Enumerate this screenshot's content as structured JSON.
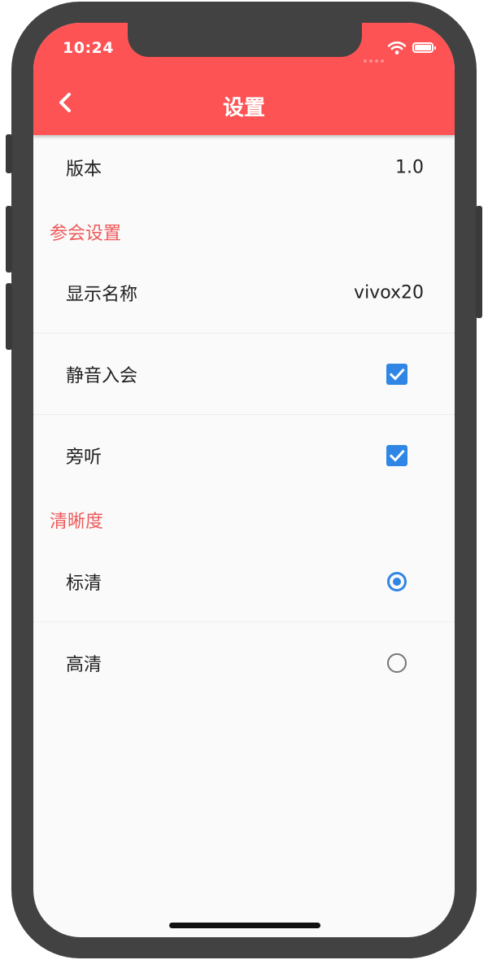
{
  "status": {
    "time": "10:24"
  },
  "appbar": {
    "title": "设置",
    "back_icon": "chevron-left-icon"
  },
  "version": {
    "label": "版本",
    "value": "1.0"
  },
  "meeting_section": {
    "header": "参会设置",
    "display_name": {
      "label": "显示名称",
      "value": "vivox20"
    },
    "mute_on_join": {
      "label": "静音入会",
      "checked": true
    },
    "audit": {
      "label": "旁听",
      "checked": true
    }
  },
  "quality_section": {
    "header": "清晰度",
    "options": [
      {
        "label": "标清",
        "selected": true
      },
      {
        "label": "高清",
        "selected": false
      }
    ]
  },
  "colors": {
    "accent": "#fe5355",
    "section_header": "#ee5a5c",
    "control": "#2f86e4"
  }
}
